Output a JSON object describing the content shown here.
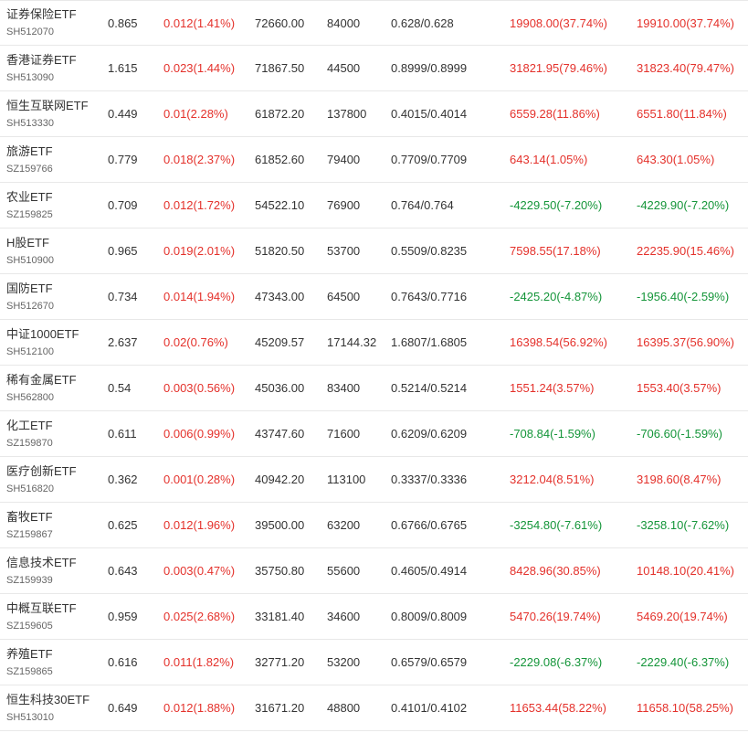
{
  "colors": {
    "up": "#e4312b",
    "down": "#149539",
    "text": "#333333",
    "code": "#666666",
    "border": "#e8e8e8"
  },
  "rows": [
    {
      "name": "证券保险ETF",
      "code": "SH512070",
      "price": "0.865",
      "change": "0.012(1.41%)",
      "change_dir": "up",
      "scale": "72660.00",
      "shares": "84000",
      "nav": "0.628/0.628",
      "pl1": "19908.00(37.74%)",
      "pl1_dir": "up",
      "pl2": "19910.00(37.74%)",
      "pl2_dir": "up"
    },
    {
      "name": "香港证券ETF",
      "code": "SH513090",
      "price": "1.615",
      "change": "0.023(1.44%)",
      "change_dir": "up",
      "scale": "71867.50",
      "shares": "44500",
      "nav": "0.8999/0.8999",
      "pl1": "31821.95(79.46%)",
      "pl1_dir": "up",
      "pl2": "31823.40(79.47%)",
      "pl2_dir": "up"
    },
    {
      "name": "恒生互联网ETF",
      "code": "SH513330",
      "price": "0.449",
      "change": "0.01(2.28%)",
      "change_dir": "up",
      "scale": "61872.20",
      "shares": "137800",
      "nav": "0.4015/0.4014",
      "pl1": "6559.28(11.86%)",
      "pl1_dir": "up",
      "pl2": "6551.80(11.84%)",
      "pl2_dir": "up"
    },
    {
      "name": "旅游ETF",
      "code": "SZ159766",
      "price": "0.779",
      "change": "0.018(2.37%)",
      "change_dir": "up",
      "scale": "61852.60",
      "shares": "79400",
      "nav": "0.7709/0.7709",
      "pl1": "643.14(1.05%)",
      "pl1_dir": "up",
      "pl2": "643.30(1.05%)",
      "pl2_dir": "up"
    },
    {
      "name": "农业ETF",
      "code": "SZ159825",
      "price": "0.709",
      "change": "0.012(1.72%)",
      "change_dir": "up",
      "scale": "54522.10",
      "shares": "76900",
      "nav": "0.764/0.764",
      "pl1": "-4229.50(-7.20%)",
      "pl1_dir": "down",
      "pl2": "-4229.90(-7.20%)",
      "pl2_dir": "down"
    },
    {
      "name": "H股ETF",
      "code": "SH510900",
      "price": "0.965",
      "change": "0.019(2.01%)",
      "change_dir": "up",
      "scale": "51820.50",
      "shares": "53700",
      "nav": "0.5509/0.8235",
      "pl1": "7598.55(17.18%)",
      "pl1_dir": "up",
      "pl2": "22235.90(15.46%)",
      "pl2_dir": "up"
    },
    {
      "name": "国防ETF",
      "code": "SH512670",
      "price": "0.734",
      "change": "0.014(1.94%)",
      "change_dir": "up",
      "scale": "47343.00",
      "shares": "64500",
      "nav": "0.7643/0.7716",
      "pl1": "-2425.20(-4.87%)",
      "pl1_dir": "down",
      "pl2": "-1956.40(-2.59%)",
      "pl2_dir": "down"
    },
    {
      "name": "中证1000ETF",
      "code": "SH512100",
      "price": "2.637",
      "change": "0.02(0.76%)",
      "change_dir": "up",
      "scale": "45209.57",
      "shares": "17144.32",
      "nav": "1.6807/1.6805",
      "pl1": "16398.54(56.92%)",
      "pl1_dir": "up",
      "pl2": "16395.37(56.90%)",
      "pl2_dir": "up"
    },
    {
      "name": "稀有金属ETF",
      "code": "SH562800",
      "price": "0.54",
      "change": "0.003(0.56%)",
      "change_dir": "up",
      "scale": "45036.00",
      "shares": "83400",
      "nav": "0.5214/0.5214",
      "pl1": "1551.24(3.57%)",
      "pl1_dir": "up",
      "pl2": "1553.40(3.57%)",
      "pl2_dir": "up"
    },
    {
      "name": "化工ETF",
      "code": "SZ159870",
      "price": "0.611",
      "change": "0.006(0.99%)",
      "change_dir": "up",
      "scale": "43747.60",
      "shares": "71600",
      "nav": "0.6209/0.6209",
      "pl1": "-708.84(-1.59%)",
      "pl1_dir": "down",
      "pl2": "-706.60(-1.59%)",
      "pl2_dir": "down"
    },
    {
      "name": "医疗创新ETF",
      "code": "SH516820",
      "price": "0.362",
      "change": "0.001(0.28%)",
      "change_dir": "up",
      "scale": "40942.20",
      "shares": "113100",
      "nav": "0.3337/0.3336",
      "pl1": "3212.04(8.51%)",
      "pl1_dir": "up",
      "pl2": "3198.60(8.47%)",
      "pl2_dir": "up"
    },
    {
      "name": "畜牧ETF",
      "code": "SZ159867",
      "price": "0.625",
      "change": "0.012(1.96%)",
      "change_dir": "up",
      "scale": "39500.00",
      "shares": "63200",
      "nav": "0.6766/0.6765",
      "pl1": "-3254.80(-7.61%)",
      "pl1_dir": "down",
      "pl2": "-3258.10(-7.62%)",
      "pl2_dir": "down"
    },
    {
      "name": "信息技术ETF",
      "code": "SZ159939",
      "price": "0.643",
      "change": "0.003(0.47%)",
      "change_dir": "up",
      "scale": "35750.80",
      "shares": "55600",
      "nav": "0.4605/0.4914",
      "pl1": "8428.96(30.85%)",
      "pl1_dir": "up",
      "pl2": "10148.10(20.41%)",
      "pl2_dir": "up"
    },
    {
      "name": "中概互联ETF",
      "code": "SZ159605",
      "price": "0.959",
      "change": "0.025(2.68%)",
      "change_dir": "up",
      "scale": "33181.40",
      "shares": "34600",
      "nav": "0.8009/0.8009",
      "pl1": "5470.26(19.74%)",
      "pl1_dir": "up",
      "pl2": "5469.20(19.74%)",
      "pl2_dir": "up"
    },
    {
      "name": "养殖ETF",
      "code": "SZ159865",
      "price": "0.616",
      "change": "0.011(1.82%)",
      "change_dir": "up",
      "scale": "32771.20",
      "shares": "53200",
      "nav": "0.6579/0.6579",
      "pl1": "-2229.08(-6.37%)",
      "pl1_dir": "down",
      "pl2": "-2229.40(-6.37%)",
      "pl2_dir": "down"
    },
    {
      "name": "恒生科技30ETF",
      "code": "SH513010",
      "price": "0.649",
      "change": "0.012(1.88%)",
      "change_dir": "up",
      "scale": "31671.20",
      "shares": "48800",
      "nav": "0.4101/0.4102",
      "pl1": "11653.44(58.22%)",
      "pl1_dir": "up",
      "pl2": "11658.10(58.25%)",
      "pl2_dir": "up"
    }
  ]
}
